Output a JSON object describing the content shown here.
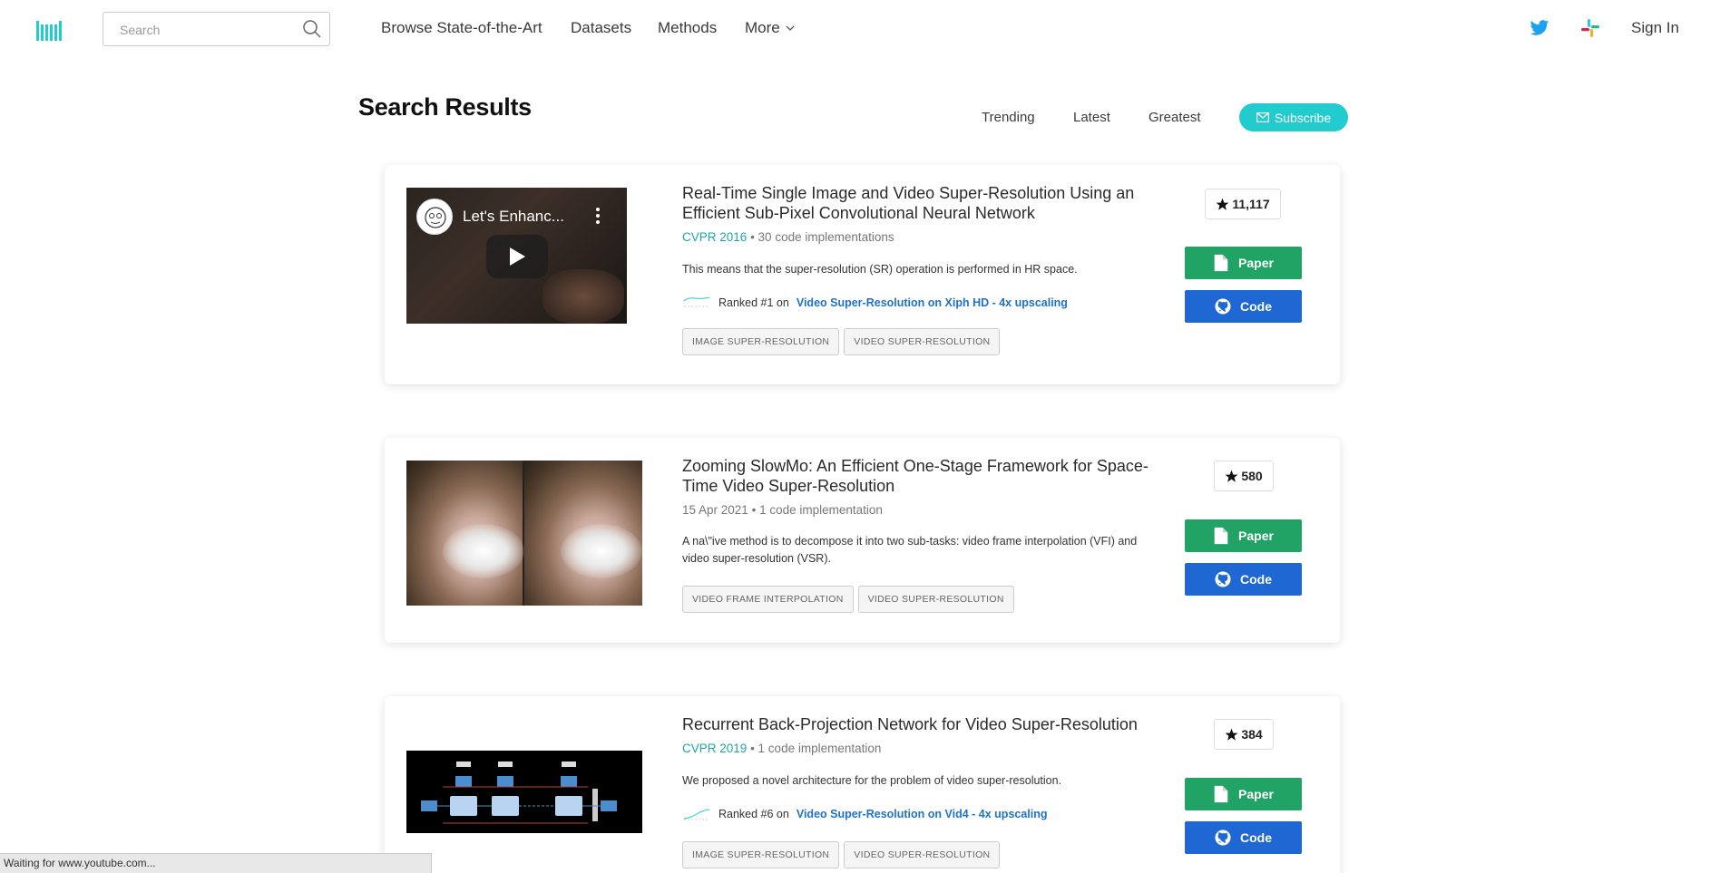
{
  "header": {
    "search_placeholder": "Search",
    "nav": [
      "Browse State-of-the-Art",
      "Datasets",
      "Methods"
    ],
    "more_label": "More",
    "signin": "Sign In"
  },
  "page": {
    "title": "Search Results",
    "sort": [
      "Trending",
      "Latest",
      "Greatest"
    ],
    "subscribe": "Subscribe"
  },
  "results": [
    {
      "title": "Real-Time Single Image and Video Super-Resolution Using an Efficient Sub-Pixel Convolutional Neural Network",
      "venue": "CVPR 2016",
      "impl": "30 code implementations",
      "abstract": "This means that the super-resolution (SR) operation is performed in HR space.",
      "rank_prefix": "Ranked #1 on",
      "rank_link": "Video Super-Resolution on Xiph HD - 4x upscaling",
      "tags": [
        "IMAGE SUPER-RESOLUTION",
        "VIDEO SUPER-RESOLUTION"
      ],
      "stars": "11,117",
      "paper": "Paper",
      "code": "Code",
      "thumb_title": "Let's Enhanc..."
    },
    {
      "title": "Zooming SlowMo: An Efficient One-Stage Framework for Space-Time Video Super-Resolution",
      "venue": "",
      "date": "15 Apr 2021",
      "impl": "1 code implementation",
      "abstract": "A na\\\"ive method is to decompose it into two sub-tasks: video frame interpolation (VFI) and video super-resolution (VSR).",
      "tags": [
        "VIDEO FRAME INTERPOLATION",
        "VIDEO SUPER-RESOLUTION"
      ],
      "stars": "580",
      "paper": "Paper",
      "code": "Code"
    },
    {
      "title": "Recurrent Back-Projection Network for Video Super-Resolution",
      "venue": "CVPR 2019",
      "impl": "1 code implementation",
      "abstract": "We proposed a novel architecture for the problem of video super-resolution.",
      "rank_prefix": "Ranked #6 on",
      "rank_link": "Video Super-Resolution on Vid4 - 4x upscaling",
      "tags": [
        "IMAGE SUPER-RESOLUTION",
        "VIDEO SUPER-RESOLUTION"
      ],
      "stars": "384",
      "paper": "Paper",
      "code": "Code"
    }
  ],
  "status_bar": "Waiting for www.youtube.com...",
  "colors": {
    "accent": "#21cbce",
    "paper_btn": "#21a366",
    "code_btn": "#1f67d2",
    "link": "#1f72c9"
  }
}
